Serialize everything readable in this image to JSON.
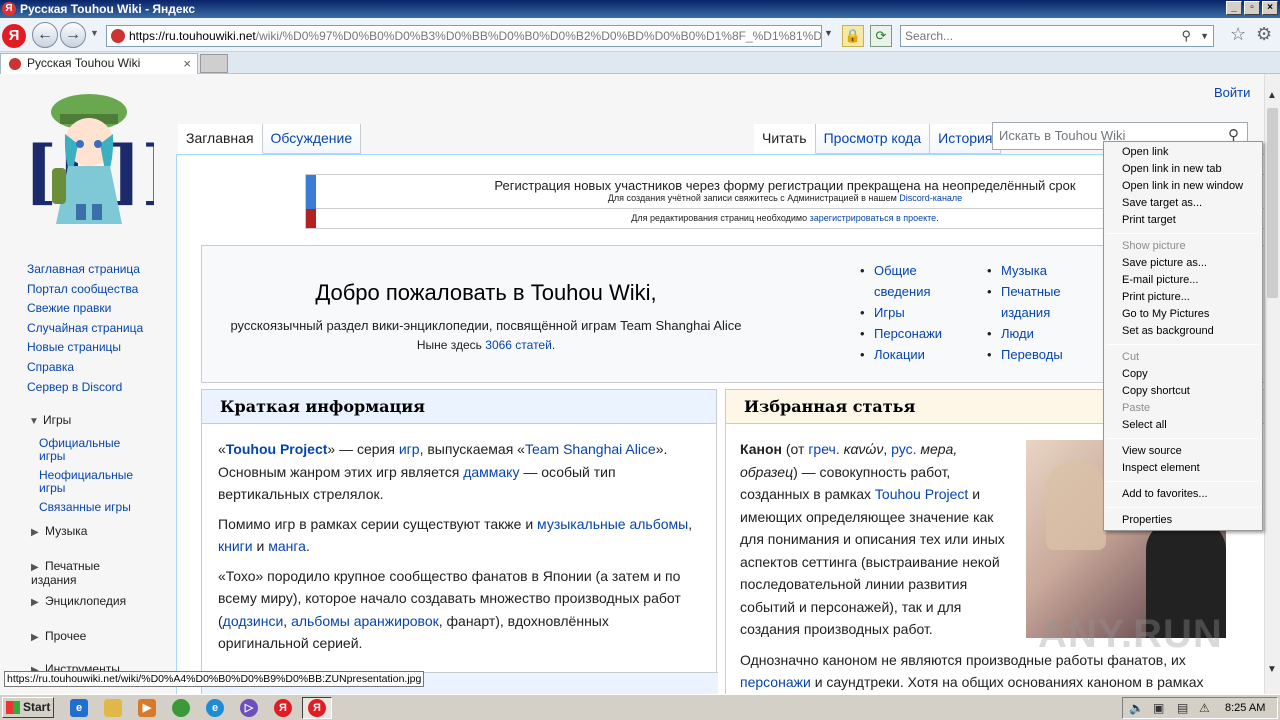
{
  "window": {
    "title": "Русская Touhou Wiki - Яндекс",
    "app_icon": "Я"
  },
  "toolbar": {
    "url_host": "https://ru.touhouwiki.net",
    "url_path": "/wiki/%D0%97%D0%B0%D0%B3%D0%BB%D0%B0%D0%B2%D0%BD%D0%B0%D1%8F_%D1%81%D1%82%D",
    "search_placeholder": "Search..."
  },
  "tabs": [
    {
      "label": "Русская Touhou Wiki"
    }
  ],
  "wiki": {
    "login": "Войти",
    "page_tabs_left": [
      "Заглавная",
      "Обсуждение"
    ],
    "page_tabs_right": [
      "Читать",
      "Просмотр кода",
      "История"
    ],
    "search_placeholder": "Искать в Touhou Wiki",
    "notice1_line1": "Регистрация новых участников через форму регистрации прекращена на неопределённый срок",
    "notice1_line2": "Для создания учётной записи свяжитесь с Администрацией в нашем",
    "notice1_link": "Discord-канале",
    "notice2_text": "Для редактирования страниц необходимо",
    "notice2_link": "зарегистрироваться в проекте",
    "welcome_title": "Добро пожаловать в Touhou Wiki,",
    "welcome_sub": "русскоязычный раздел вики-энциклопедии, посвящённой играм Team Shanghai Alice",
    "welcome_count_pre": "Ныне здесь",
    "welcome_count_link": "3066 статей",
    "portal_col1": [
      "Общие сведения",
      "Игры",
      "Персонажи",
      "Локации"
    ],
    "portal_col2": [
      "Музыка",
      "Печатные издания",
      "Люди",
      "Переводы"
    ],
    "brief_title": "Краткая информация",
    "featured_title": "Избранная статья"
  },
  "brief": {
    "p1": [
      "«",
      "Touhou Project",
      "» — серия ",
      "игр",
      ", выпускаемая «",
      "Team Shanghai Alice",
      "». Основным жанром этих игр является ",
      "даммаку",
      " — особый тип вертикальных стрелялок."
    ],
    "p2": [
      "Помимо игр в рамках серии существуют также и ",
      "музыкальные альбомы",
      ", ",
      "книги",
      " и ",
      "манга",
      "."
    ],
    "p3": [
      "«Тохо» породило крупное сообщество фанатов в Японии (а затем и по всему миру), которое начало создавать множество производных работ (",
      "додзинси",
      ", ",
      "альбомы аранжировок",
      ", фанарт), вдохновлённых оригинальной серией."
    ]
  },
  "featured": {
    "p1": [
      "Канон",
      " (от ",
      "греч.",
      " ",
      "κανών",
      ", ",
      "рус.",
      " ",
      "мера, образец",
      ") — совокупность работ, созданных в рамках ",
      "Touhou Project",
      " и имеющих определяющее значение как для понимания и описания тех или иных аспектов сеттинга (выстраивание некой последовательной линии развития событий и персонажей), так и для создания производных работ."
    ],
    "p2": [
      "Однозначно каноном не являются производные работы фанатов, их ",
      "персонажи",
      " и саундтреки. Хотя на общих основаниях каноном в рамках"
    ]
  },
  "sidebar": {
    "main": [
      "Заглавная страница",
      "Портал сообщества",
      "Свежие правки",
      "Случайная страница",
      "Новые страницы",
      "Справка",
      "Сервер в Discord"
    ],
    "games_label": "Игры",
    "games_items": [
      "Официальные игры",
      "Неофициальные игры",
      "Связанные игры"
    ],
    "sections": [
      "Музыка",
      "Печатные издания",
      "Энциклопедия",
      "Прочее",
      "Инструменты"
    ]
  },
  "context_menu": [
    {
      "label": "Open link",
      "disabled": false
    },
    {
      "label": "Open link in new tab",
      "disabled": false
    },
    {
      "label": "Open link in new window",
      "disabled": false
    },
    {
      "label": "Save target as...",
      "disabled": false
    },
    {
      "label": "Print target",
      "disabled": false
    },
    {
      "label": "Show picture",
      "disabled": true
    },
    {
      "label": "Save picture as...",
      "disabled": false
    },
    {
      "label": "E-mail picture...",
      "disabled": false
    },
    {
      "label": "Print picture...",
      "disabled": false
    },
    {
      "label": "Go to My Pictures",
      "disabled": false
    },
    {
      "label": "Set as background",
      "disabled": false
    },
    {
      "label": "Cut",
      "disabled": true
    },
    {
      "label": "Copy",
      "disabled": false
    },
    {
      "label": "Copy shortcut",
      "disabled": false
    },
    {
      "label": "Paste",
      "disabled": true
    },
    {
      "label": "Select all",
      "disabled": false
    },
    {
      "label": "View source",
      "disabled": false
    },
    {
      "label": "Inspect element",
      "disabled": false
    },
    {
      "label": "Add to favorites...",
      "disabled": false
    },
    {
      "label": "Properties",
      "disabled": false
    }
  ],
  "status_link": "https://ru.touhouwiki.net/wiki/%D0%A4%D0%B0%D0%B9%D0%BB:ZUNpresentation.jpg",
  "watermark": "ANY.RUN",
  "taskbar": {
    "start_label": "Start",
    "clock": "8:25 AM"
  },
  "colors": {
    "link": "#0645ad",
    "title_bar": "#0a246a",
    "yandex_red": "#e31b23"
  }
}
